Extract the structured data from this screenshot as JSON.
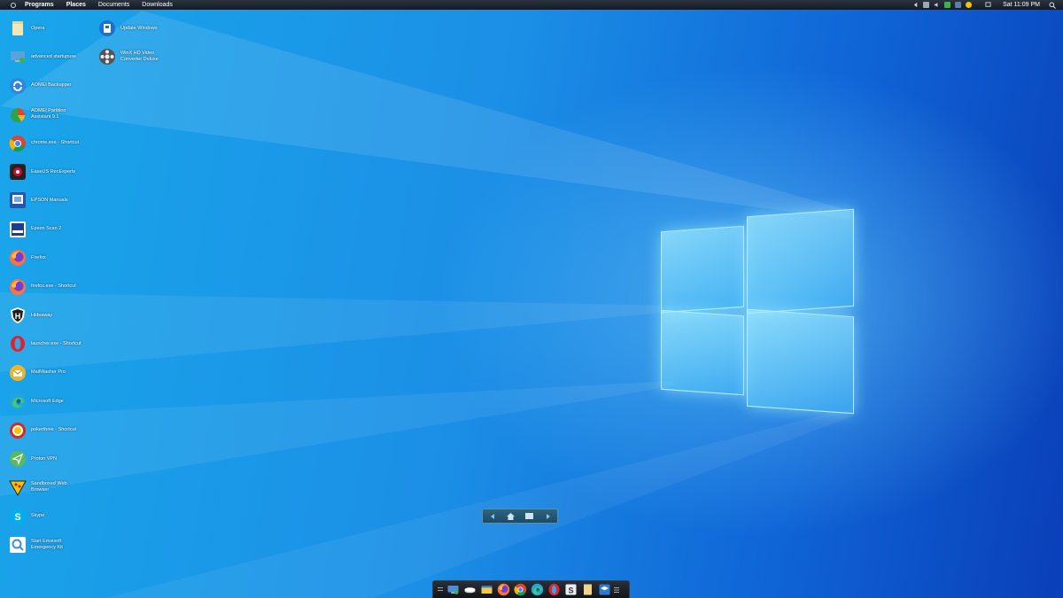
{
  "menubar": {
    "menus": [
      {
        "label": "Programs",
        "bold": true
      },
      {
        "label": "Places",
        "bold": true
      },
      {
        "label": "Documents",
        "bold": false
      },
      {
        "label": "Downloads",
        "bold": false
      }
    ],
    "clock": "Sat 11:09 PM"
  },
  "desktop_icons": [
    {
      "label": "Opera",
      "icon": "folder-icon",
      "color": "#f5e7b4"
    },
    {
      "label": "advanced startupuse",
      "icon": "monitor-icon",
      "color": "#5aa3d8"
    },
    {
      "label": "AOMEI Backupper",
      "icon": "backup-icon",
      "color": "#2f86e0"
    },
    {
      "label": "AOMEI Partition Assistant 9.1",
      "icon": "partition-icon",
      "color": "#e0452f"
    },
    {
      "label": "chrome.exe - Shortcut",
      "icon": "chrome-icon",
      "color": "#db4437"
    },
    {
      "label": "EaseUS RecExperts",
      "icon": "record-icon",
      "color": "#c8102e"
    },
    {
      "label": "EPSON Manuals",
      "icon": "epson-manual-icon",
      "color": "#2a56a8"
    },
    {
      "label": "Epson Scan 2",
      "icon": "scanner-icon",
      "color": "#1d3d8f"
    },
    {
      "label": "Firefox",
      "icon": "firefox-icon",
      "color": "#ff7139"
    },
    {
      "label": "firefox.exe - Shortcut",
      "icon": "firefox-icon",
      "color": "#ff7139"
    },
    {
      "label": "Hideaway",
      "icon": "shield-icon",
      "color": "#1e1e1e"
    },
    {
      "label": "launcher.exe - Shortcut",
      "icon": "opera-icon",
      "color": "#e1222a"
    },
    {
      "label": "MailWasher Pro",
      "icon": "mailwasher-icon",
      "color": "#f0b429"
    },
    {
      "label": "Microsoft Edge",
      "icon": "edge-icon",
      "color": "#1fa6e0"
    },
    {
      "label": "pokerthnie - Shortcut",
      "icon": "poker-icon",
      "color": "#d8291c"
    },
    {
      "label": "Proton VPN",
      "icon": "vpn-icon",
      "color": "#5cb85c"
    },
    {
      "label": "Sandboxed Web Browser",
      "icon": "sandbox-icon",
      "color": "#f4c400"
    },
    {
      "label": "Skype",
      "icon": "skype-icon",
      "color": "#00aff0"
    },
    {
      "label": "Start Emsisoft Emergency Kit",
      "icon": "magnifier-icon",
      "color": "#3a8fd6"
    }
  ],
  "desktop_icons_col2": [
    {
      "label": "Update Windows",
      "icon": "update-icon",
      "color": "#1f6fcf"
    },
    {
      "label": "WinX HD Video Converter Deluxe",
      "icon": "film-reel-icon",
      "color": "#333333"
    }
  ],
  "dock_items": [
    {
      "icon": "monitor-icon",
      "color": "#4b8ed6"
    },
    {
      "icon": "drive-icon",
      "color": "#d7dbe0"
    },
    {
      "icon": "explorer-icon",
      "color": "#f2c84b"
    },
    {
      "icon": "firefox-icon",
      "color": "#ff7139"
    },
    {
      "icon": "chrome-icon",
      "color": "#db4437"
    },
    {
      "icon": "edge-icon",
      "color": "#1fa6e0"
    },
    {
      "icon": "opera-icon",
      "color": "#e1222a"
    },
    {
      "icon": "s-app-icon",
      "color": "#8aa0b5"
    },
    {
      "icon": "folder-icon",
      "color": "#f0d58a"
    },
    {
      "icon": "box-icon",
      "color": "#2b7bd1"
    }
  ],
  "navbar": [
    "back-arrow-icon",
    "home-icon",
    "desktop-icon",
    "forward-arrow-icon"
  ],
  "colors": {
    "wallpaper_light": "#1aa6ea",
    "wallpaper_dark": "#0a3fb8",
    "menubar": "#1c222b",
    "navbar": "#245670"
  }
}
